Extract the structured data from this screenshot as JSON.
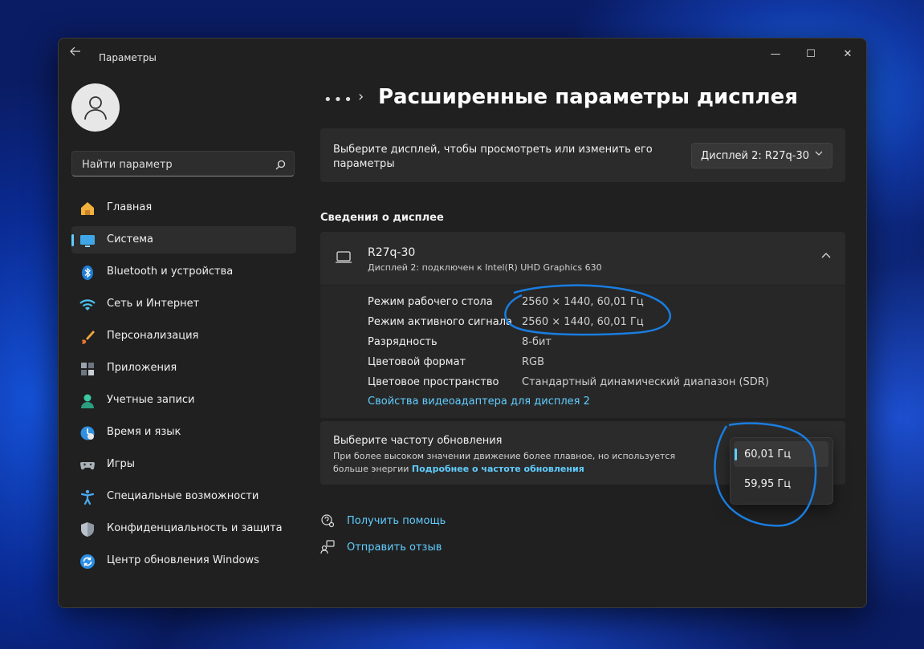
{
  "window": {
    "app_title": "Параметры",
    "back_icon": "back-arrow-icon",
    "controls": {
      "minimize": "—",
      "maximize": "☐",
      "close": "✕"
    }
  },
  "sidebar": {
    "search": {
      "placeholder": "Найти параметр",
      "value": ""
    },
    "items": [
      {
        "label": "Главная",
        "icon": "home-icon"
      },
      {
        "label": "Система",
        "icon": "system-icon",
        "active": true
      },
      {
        "label": "Bluetooth и устройства",
        "icon": "bluetooth-icon"
      },
      {
        "label": "Сеть и Интернет",
        "icon": "wifi-icon"
      },
      {
        "label": "Персонализация",
        "icon": "brush-icon"
      },
      {
        "label": "Приложения",
        "icon": "apps-icon"
      },
      {
        "label": "Учетные записи",
        "icon": "accounts-icon"
      },
      {
        "label": "Время и язык",
        "icon": "time-language-icon"
      },
      {
        "label": "Игры",
        "icon": "gaming-icon"
      },
      {
        "label": "Специальные возможности",
        "icon": "accessibility-icon"
      },
      {
        "label": "Конфиденциальность и защита",
        "icon": "shield-icon"
      },
      {
        "label": "Центр обновления Windows",
        "icon": "windows-update-icon"
      }
    ]
  },
  "main": {
    "breadcrumb_more": "•••",
    "breadcrumb_sep": "›",
    "title": "Расширенные параметры дисплея",
    "display_select": {
      "label": "Выберите дисплей, чтобы просмотреть или изменить его параметры",
      "value": "Дисплей 2: R27q-30"
    },
    "section_title": "Сведения о дисплее",
    "display_info": {
      "name": "R27q-30",
      "description": "Дисплей 2: подключен к Intel(R) UHD Graphics 630",
      "rows": [
        {
          "key": "Режим рабочего стола",
          "value": "2560 × 1440, 60,01 Гц"
        },
        {
          "key": "Режим активного сигнала",
          "value": "2560 × 1440, 60,01 Гц"
        },
        {
          "key": "Разрядность",
          "value": "8-бит"
        },
        {
          "key": "Цветовой формат",
          "value": "RGB"
        },
        {
          "key": "Цветовое пространство",
          "value": "Стандартный динамический диапазон (SDR)"
        }
      ],
      "adapter_link": "Свойства видеоадаптера для дисплея 2"
    },
    "refresh": {
      "title": "Выберите частоту обновления",
      "subtitle": "При более высоком значении движение более плавное, но используется больше энергии",
      "more_link": "Подробнее о частоте обновления",
      "options": [
        "60,01 Гц",
        "59,95 Гц"
      ],
      "selected": "60,01 Гц"
    },
    "help_links": [
      {
        "label": "Получить помощь",
        "icon": "help-icon"
      },
      {
        "label": "Отправить отзыв",
        "icon": "feedback-icon"
      }
    ]
  },
  "colors": {
    "accent": "#60cdff",
    "annotation": "#1a7de0"
  }
}
